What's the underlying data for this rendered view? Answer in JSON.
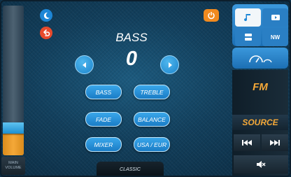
{
  "header": {
    "title": "BASS",
    "value": "0"
  },
  "buttons": {
    "bass": "BASS",
    "treble": "TREBLE",
    "fade": "FADE",
    "balance": "BALANCE",
    "mixer": "MIXER",
    "usa_eur": "USA / EUR"
  },
  "preset_tab": "CLASSIC",
  "volume": {
    "label": "MAIN\nVOLUME",
    "level_fraction": 0.18
  },
  "right_panel": {
    "nav_label": "NW",
    "fm_label": "FM",
    "source_label": "SOURCE"
  },
  "icons": {
    "night": "moon-icon",
    "back": "back-arrow-icon",
    "power": "power-icon",
    "music": "music-note-icon",
    "video": "video-icon",
    "apps": "apps-icon",
    "gauge": "gauge-icon",
    "prev": "skip-back-icon",
    "next": "skip-forward-icon",
    "mute": "mute-icon"
  },
  "colors": {
    "accent_blue": "#1d86d6",
    "accent_orange": "#f4a838",
    "back_red": "#e84a2c",
    "power_orange": "#f08a1f"
  }
}
